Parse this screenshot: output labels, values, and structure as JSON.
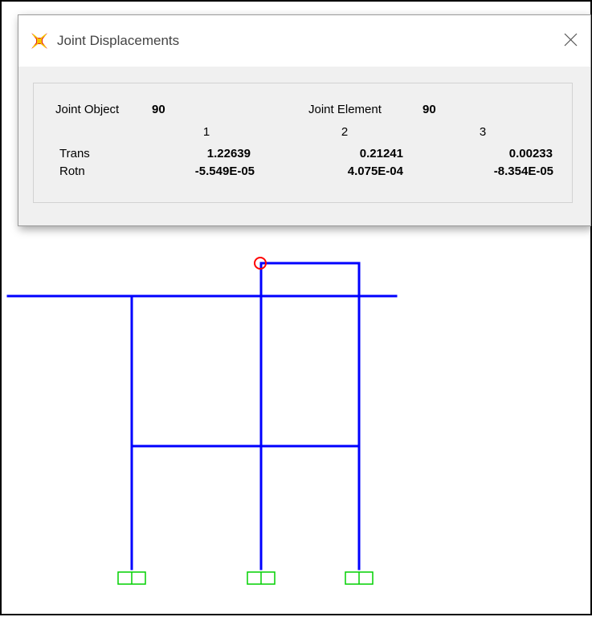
{
  "dialog": {
    "title": "Joint Displacements",
    "joint_object_label": "Joint  Object",
    "joint_object_value": "90",
    "joint_element_label": "Joint Element",
    "joint_element_value": "90",
    "columns": [
      "1",
      "2",
      "3"
    ],
    "rows": [
      {
        "label": "Trans",
        "values": [
          "1.22639",
          "0.21241",
          "0.00233"
        ]
      },
      {
        "label": "Rotn",
        "values": [
          "-5.549E-05",
          "4.075E-04",
          "-8.354E-05"
        ]
      }
    ]
  },
  "colors": {
    "frame_members": "#0000ff",
    "supports": "#00d000",
    "selected_joint": "#ff0000",
    "dialog_background": "#f0f0f0",
    "titlebar_background": "#ffffff"
  },
  "icons": {
    "app": "sap2000-logo-icon",
    "close": "close-icon",
    "support": "fixed-support-icon",
    "selected_joint": "selected-joint-marker"
  }
}
